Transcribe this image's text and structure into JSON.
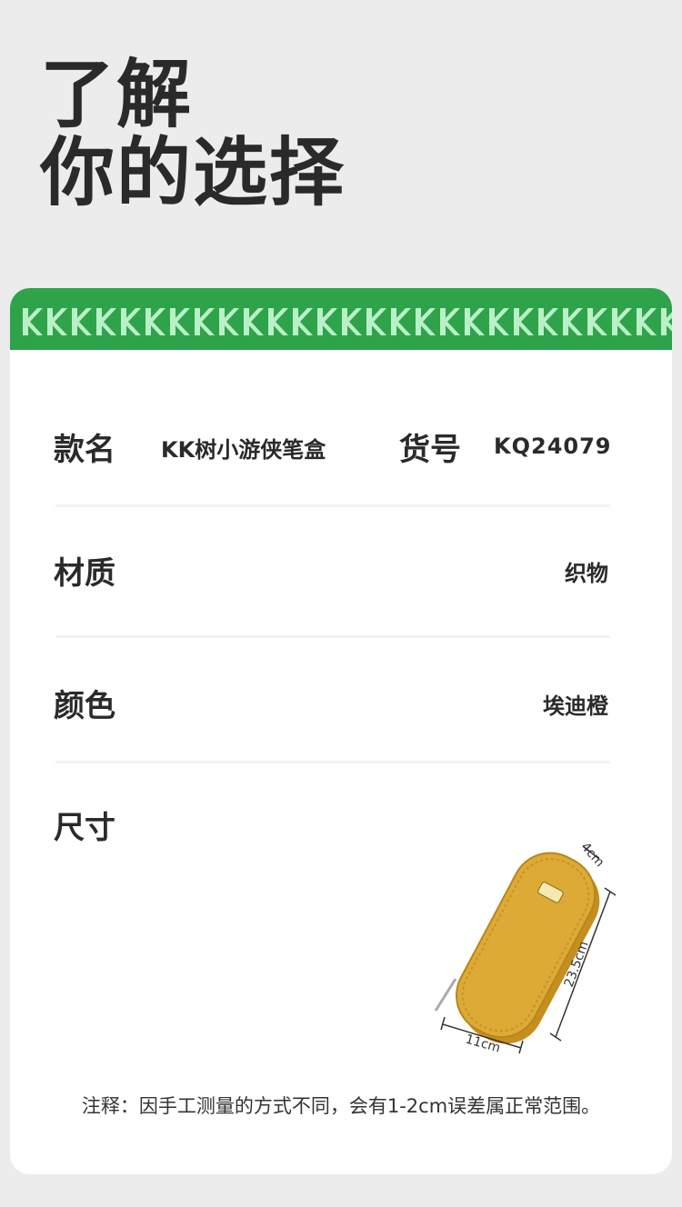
{
  "hero": {
    "line1": "了解",
    "line2": "你的选择"
  },
  "banner": {
    "pattern_color": "#2fa34a",
    "pattern_mark": "K"
  },
  "specs": {
    "name_label": "款名",
    "name_value": "KK树小游侠笔盒",
    "sku_label": "货号",
    "sku_value": "KQ24079",
    "material_label": "材质",
    "material_value": "织物",
    "color_label": "颜色",
    "color_value": "埃迪橙",
    "size_label": "尺寸"
  },
  "dimensions": {
    "depth": "4cm",
    "height": "23.5cm",
    "width": "11cm"
  },
  "product": {
    "color": "#d9a52a",
    "tag_text": "KK树 小游侠"
  },
  "note": "注释：因手工测量的方式不同，会有1-2cm误差属正常范围。"
}
